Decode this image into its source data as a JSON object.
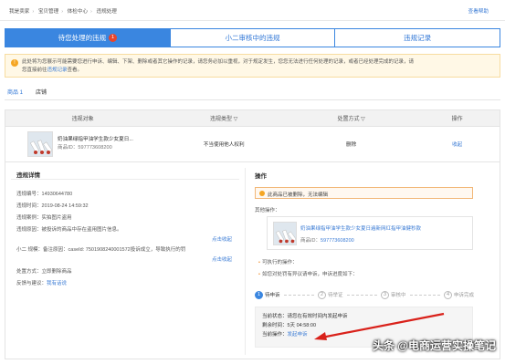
{
  "breadcrumb": [
    "我是卖家",
    "宝贝管理",
    "体检中心",
    "违规处理"
  ],
  "help_link": "查看帮助",
  "tabs": [
    {
      "label": "待您处理的违规",
      "badge": "1",
      "active": true
    },
    {
      "label": "小二审核中的违规",
      "active": false
    },
    {
      "label": "违规记录",
      "active": false
    }
  ],
  "notice": {
    "text_a": "此处将为您展示可能需要您进行申诉、编辑、下架、删除或者其它操作的记录，请您务必加以重视，对于规定发生，您您无法进行任何处理的记录，或者已经处理完成的记录，请",
    "text_b": "您直接前往",
    "link": "违规记录",
    "text_c": "查看。"
  },
  "subtabs": [
    {
      "label": "商品 1",
      "active": true
    },
    {
      "label": "店铺",
      "active": false
    }
  ],
  "table": {
    "headers": [
      "违规对象",
      "违规类型 ▽",
      "处置方式 ▽",
      "操作"
    ],
    "row": {
      "title": "奶油果绿指甲油学生款少女夏日...",
      "item_id": "商品ID：597773608200",
      "type": "不当使用他人权利",
      "action": "删除",
      "op": "收起"
    }
  },
  "detail": {
    "title": "违规详情",
    "fields": [
      {
        "label": "违规编号：",
        "value": "14930644780"
      },
      {
        "label": "违规时间：",
        "value": "2019-08-24 14:59:32"
      },
      {
        "label": "违规案例：",
        "value": "实拍图片盗用"
      },
      {
        "label": "违规原因：",
        "value": "被投诉的商品中存在盗用图片信息。"
      }
    ],
    "expand1": "点击收起",
    "remark": "小二 规模：备注原因：caseId: 7501908240001572投诉成立，导致执行的罚",
    "expand2": "点击收起",
    "punishment": {
      "label": "处置方式：",
      "value": "立即删除商品"
    },
    "feedback": {
      "label": "反馈与建议：",
      "link": "我有话说"
    }
  },
  "operation": {
    "title": "操作",
    "warn": "此商品已被删除，无法编辑",
    "other_ops": "其他操作：",
    "product_title": "奶油果绿指甲油学生款少女夏日遍新网红指甲油健秒款",
    "product_id_label": "商品ID：",
    "product_id": "597773608200",
    "can_do": "可执行的操作：",
    "appeal_line": "如您对处罚有异议请申诉，申诉进度如下：",
    "steps": [
      {
        "num": "1",
        "label": "待申诉",
        "active": true
      },
      {
        "num": "2",
        "label": "待举证",
        "active": false
      },
      {
        "num": "3",
        "label": "审核中",
        "active": false
      },
      {
        "num": "4",
        "label": "申诉完成",
        "active": false
      }
    ],
    "status_line": "当前状态：请您在有效时间内发起申诉",
    "remaining": "剩余时间：5天 04:58:00",
    "current_op_label": "当前操作：",
    "current_op_link": "发起申诉"
  },
  "watermark": "头条 @电商运营实操笔记",
  "colors": {
    "primary": "#3a86e0",
    "badge": "#e8452c",
    "notice_bg": "#fff8e6",
    "arrow": "#d9211a"
  }
}
